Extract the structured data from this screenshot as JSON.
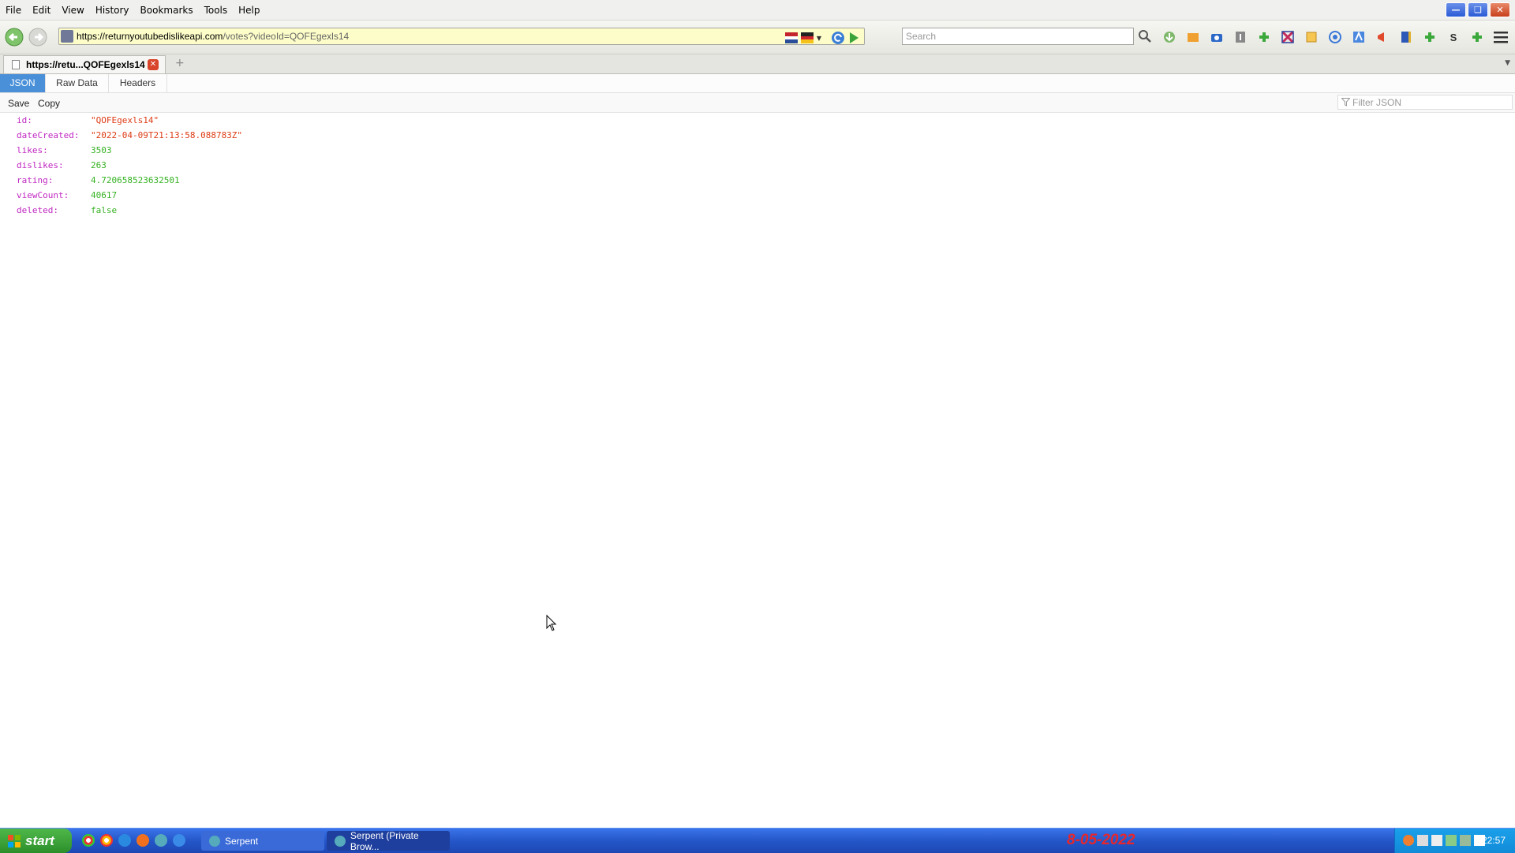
{
  "menu": {
    "items": [
      "File",
      "Edit",
      "View",
      "History",
      "Bookmarks",
      "Tools",
      "Help"
    ]
  },
  "nav": {
    "url_host": "https://returnyoutubedislikeapi.com",
    "url_path": "/votes?videoId=QOFEgexls14",
    "search_placeholder": "Search"
  },
  "tabs": {
    "active_title": "https://retu...QOFEgexls14"
  },
  "viewer": {
    "tabs": [
      "JSON",
      "Raw Data",
      "Headers"
    ],
    "save_label": "Save",
    "copy_label": "Copy",
    "filter_placeholder": "Filter JSON"
  },
  "json": [
    {
      "key": "id:",
      "value": "\"QOFEgexls14\"",
      "type": "str"
    },
    {
      "key": "dateCreated:",
      "value": "\"2022-04-09T21:13:58.088783Z\"",
      "type": "str"
    },
    {
      "key": "likes:",
      "value": "3503",
      "type": "num"
    },
    {
      "key": "dislikes:",
      "value": "263",
      "type": "num"
    },
    {
      "key": "rating:",
      "value": "4.720658523632501",
      "type": "num"
    },
    {
      "key": "viewCount:",
      "value": "40617",
      "type": "num"
    },
    {
      "key": "deleted:",
      "value": "false",
      "type": "bool"
    }
  ],
  "taskbar": {
    "start_label": "start",
    "tasks": [
      "Serpent",
      "Serpent (Private Brow..."
    ],
    "date_overlay": "8-05-2022",
    "clock": "22:57"
  },
  "colors": {
    "json_key": "#c026c2",
    "json_string": "#dd3b14",
    "json_number": "#35b222",
    "viewer_active_tab": "#4a90d9",
    "url_bar_bg": "#fdfdc9",
    "date_overlay": "#e8262b"
  }
}
